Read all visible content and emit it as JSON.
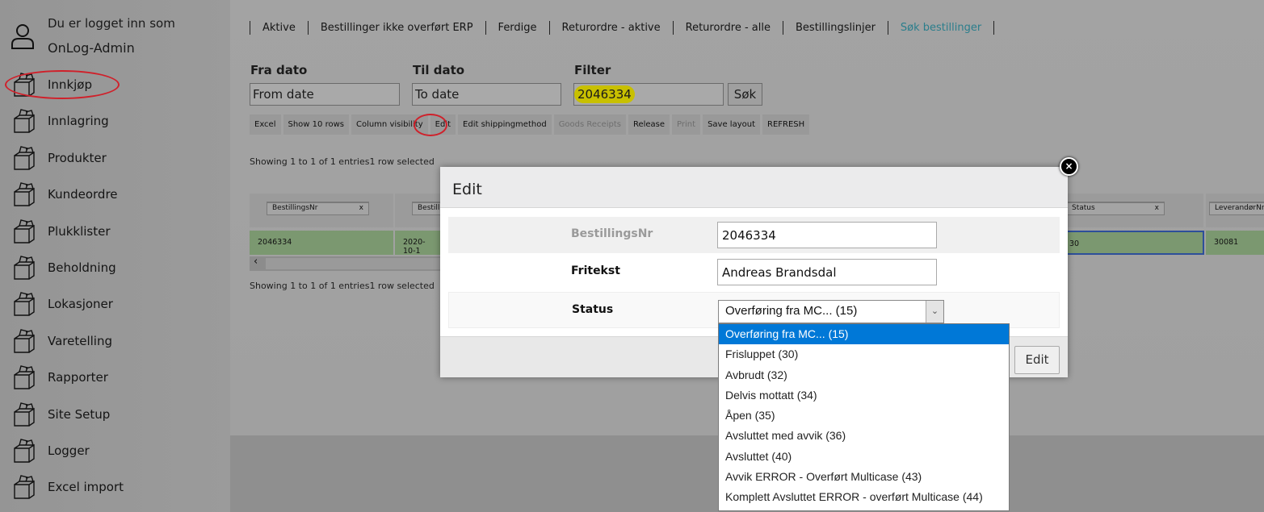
{
  "user": {
    "line1": "Du er logget inn som",
    "line2": "OnLog-Admin",
    "icon": "user-icon"
  },
  "sidebar": {
    "items": [
      {
        "label": "Innkjøp",
        "highlighted": true
      },
      {
        "label": "Innlagring"
      },
      {
        "label": "Produkter"
      },
      {
        "label": "Kundeordre"
      },
      {
        "label": "Plukklister"
      },
      {
        "label": "Beholdning"
      },
      {
        "label": "Lokasjoner"
      },
      {
        "label": "Varetelling"
      },
      {
        "label": "Rapporter"
      },
      {
        "label": "Site Setup"
      },
      {
        "label": "Logger"
      },
      {
        "label": "Excel import"
      }
    ],
    "icon": "box-icon"
  },
  "tabs": [
    {
      "label": "Aktive"
    },
    {
      "label": "Bestillinger ikke overført ERP"
    },
    {
      "label": "Ferdige"
    },
    {
      "label": "Returordre - aktive"
    },
    {
      "label": "Returordre - alle"
    },
    {
      "label": "Bestillingslinjer"
    },
    {
      "label": "Søk bestillinger",
      "active": true
    }
  ],
  "filters": {
    "from_label": "Fra dato",
    "from_placeholder": "From date",
    "to_label": "Til dato",
    "to_placeholder": "To date",
    "filter_label": "Filter",
    "filter_value": "2046334",
    "search_button": "Søk"
  },
  "toolbar": [
    {
      "label": "Excel"
    },
    {
      "label": "Show 10 rows"
    },
    {
      "label": "Column visibility"
    },
    {
      "label": "Edit",
      "highlighted": true
    },
    {
      "label": "Edit shippingmethod"
    },
    {
      "label": "Goods Receipts",
      "disabled": true
    },
    {
      "label": "Release"
    },
    {
      "label": "Print",
      "disabled": true
    },
    {
      "label": "Save layout"
    },
    {
      "label": "REFRESH"
    }
  ],
  "table": {
    "info_top": "Showing 1 to 1 of 1 entries1 row selected",
    "info_bottom": "Showing 1 to 1 of 1 entries1 row selected",
    "columns": [
      "BestillingsNr",
      "Bestilli",
      "Status",
      "LeverandørNr"
    ],
    "row": [
      "2046334",
      "2020-10-1",
      "30",
      "30081"
    ],
    "clear": "x"
  },
  "modal": {
    "title": "Edit",
    "fields": [
      {
        "label": "BestillingsNr",
        "value": "2046334"
      },
      {
        "label": "Fritekst",
        "value": "Andreas Brandsdal"
      },
      {
        "label": "Status",
        "value": "Overføring fra MC... (15)"
      }
    ],
    "submit": "Edit",
    "close_icon": "close-icon"
  },
  "dropdown": {
    "options": [
      "Overføring fra MC... (15)",
      "Frisluppet (30)",
      "Avbrudt (32)",
      "Delvis mottatt (34)",
      "Åpen (35)",
      "Avsluttet med avvik (36)",
      "Avsluttet (40)",
      "Avvik ERROR - Overført Multicase (43)",
      "Komplett Avsluttet ERROR - overført Multicase (44)"
    ],
    "selected": 0
  },
  "colors": {
    "accent_tab": "#2b7e8c",
    "selected_option": "#0078d7",
    "selected_row": "#7b9870",
    "annotation": "#d0202a",
    "highlight": "#c8c000"
  }
}
